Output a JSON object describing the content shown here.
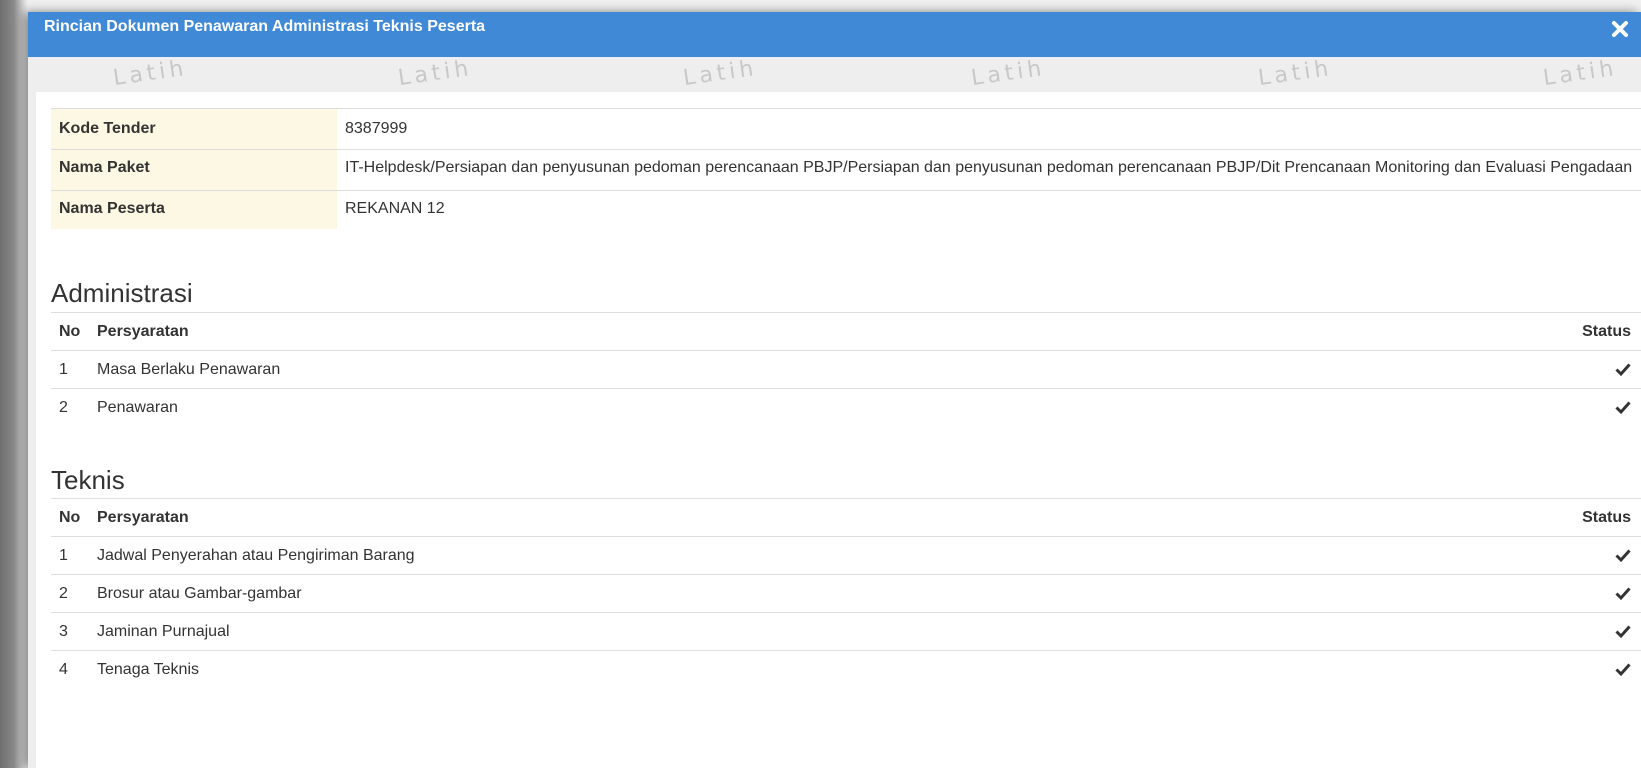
{
  "modal": {
    "title": "Rincian Dokumen Penawaran Administrasi Teknis Peserta",
    "watermark": "Latih",
    "header_color": "#3f89d6"
  },
  "info": {
    "rows": [
      {
        "label": "Kode Tender",
        "value": "8387999"
      },
      {
        "label": "Nama Paket",
        "value": "IT-Helpdesk/Persiapan dan penyusunan pedoman perencanaan PBJP/Persiapan dan penyusunan pedoman perencanaan PBJP/Dit Prencanaan Monitoring dan Evaluasi Pengadaan"
      },
      {
        "label": "Nama Peserta",
        "value": "REKANAN 12"
      }
    ]
  },
  "administrasi": {
    "title": "Administrasi",
    "headers": {
      "no": "No",
      "requirement": "Persyaratan",
      "status": "Status"
    },
    "rows": [
      {
        "no": "1",
        "requirement": "Masa Berlaku Penawaran",
        "status": "check-icon"
      },
      {
        "no": "2",
        "requirement": "Penawaran",
        "status": "check-icon"
      }
    ]
  },
  "teknis": {
    "title": "Teknis",
    "headers": {
      "no": "No",
      "requirement": "Persyaratan",
      "status": "Status"
    },
    "rows": [
      {
        "no": "1",
        "requirement": "Jadwal Penyerahan atau Pengiriman Barang",
        "status": "check-icon"
      },
      {
        "no": "2",
        "requirement": "Brosur atau Gambar-gambar",
        "status": "check-icon"
      },
      {
        "no": "3",
        "requirement": "Jaminan Purnajual",
        "status": "check-icon"
      },
      {
        "no": "4",
        "requirement": "Tenaga Teknis",
        "status": "check-icon"
      }
    ]
  }
}
